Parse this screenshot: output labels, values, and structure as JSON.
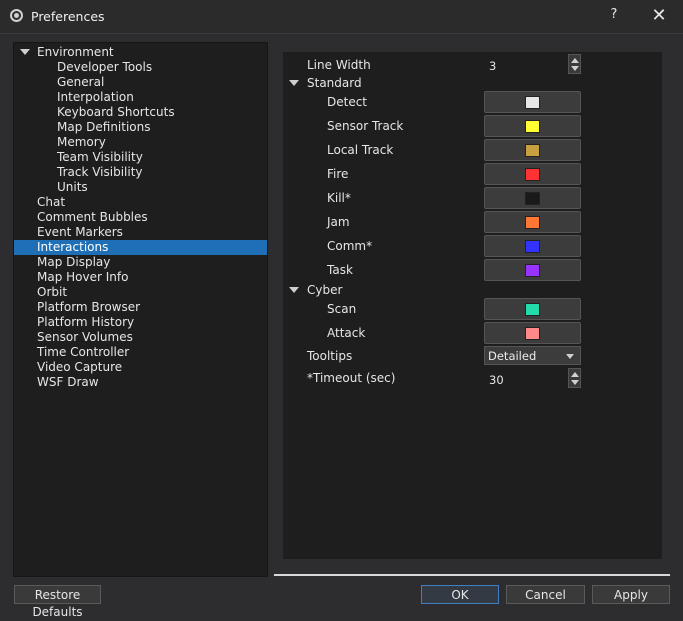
{
  "window": {
    "title": "Preferences",
    "help_label": "?",
    "close_label": "✕",
    "icon": "preferences-app-icon"
  },
  "tree": {
    "items": [
      {
        "label": "Environment",
        "level": 0,
        "expanded": true
      },
      {
        "label": "Developer Tools",
        "level": 1
      },
      {
        "label": "General",
        "level": 1
      },
      {
        "label": "Interpolation",
        "level": 1
      },
      {
        "label": "Keyboard Shortcuts",
        "level": 1
      },
      {
        "label": "Map Definitions",
        "level": 1
      },
      {
        "label": "Memory",
        "level": 1
      },
      {
        "label": "Team Visibility",
        "level": 1
      },
      {
        "label": "Track Visibility",
        "level": 1
      },
      {
        "label": "Units",
        "level": 1
      },
      {
        "label": "Chat",
        "level": 0
      },
      {
        "label": "Comment Bubbles",
        "level": 0
      },
      {
        "label": "Event Markers",
        "level": 0
      },
      {
        "label": "Interactions",
        "level": 0,
        "selected": true
      },
      {
        "label": "Map Display",
        "level": 0
      },
      {
        "label": "Map Hover Info",
        "level": 0
      },
      {
        "label": "Orbit",
        "level": 0
      },
      {
        "label": "Platform Browser",
        "level": 0
      },
      {
        "label": "Platform History",
        "level": 0
      },
      {
        "label": "Sensor Volumes",
        "level": 0
      },
      {
        "label": "Time Controller",
        "level": 0
      },
      {
        "label": "Video Capture",
        "level": 0
      },
      {
        "label": "WSF Draw",
        "level": 0
      }
    ]
  },
  "settings": {
    "line_width": {
      "label": "Line Width",
      "value": "3"
    },
    "standard": {
      "label": "Standard",
      "items": [
        {
          "label": "Detect",
          "color": "#e6e6e6"
        },
        {
          "label": "Sensor Track",
          "color": "#ffff33"
        },
        {
          "label": "Local Track",
          "color": "#c8a040"
        },
        {
          "label": "Fire",
          "color": "#ff3333"
        },
        {
          "label": "Kill*",
          "color": "#1a1a1a"
        },
        {
          "label": "Jam",
          "color": "#ff7733"
        },
        {
          "label": "Comm*",
          "color": "#3333ff"
        },
        {
          "label": "Task",
          "color": "#9933ff"
        }
      ]
    },
    "cyber": {
      "label": "Cyber",
      "items": [
        {
          "label": "Scan",
          "color": "#22ddaa"
        },
        {
          "label": "Attack",
          "color": "#ff8888"
        }
      ]
    },
    "tooltips": {
      "label": "Tooltips",
      "value": "Detailed"
    },
    "timeout": {
      "label": "*Timeout (sec)",
      "value": "30"
    }
  },
  "buttons": {
    "restore_defaults": "Restore Defaults",
    "ok": "OK",
    "cancel": "Cancel",
    "apply": "Apply"
  }
}
